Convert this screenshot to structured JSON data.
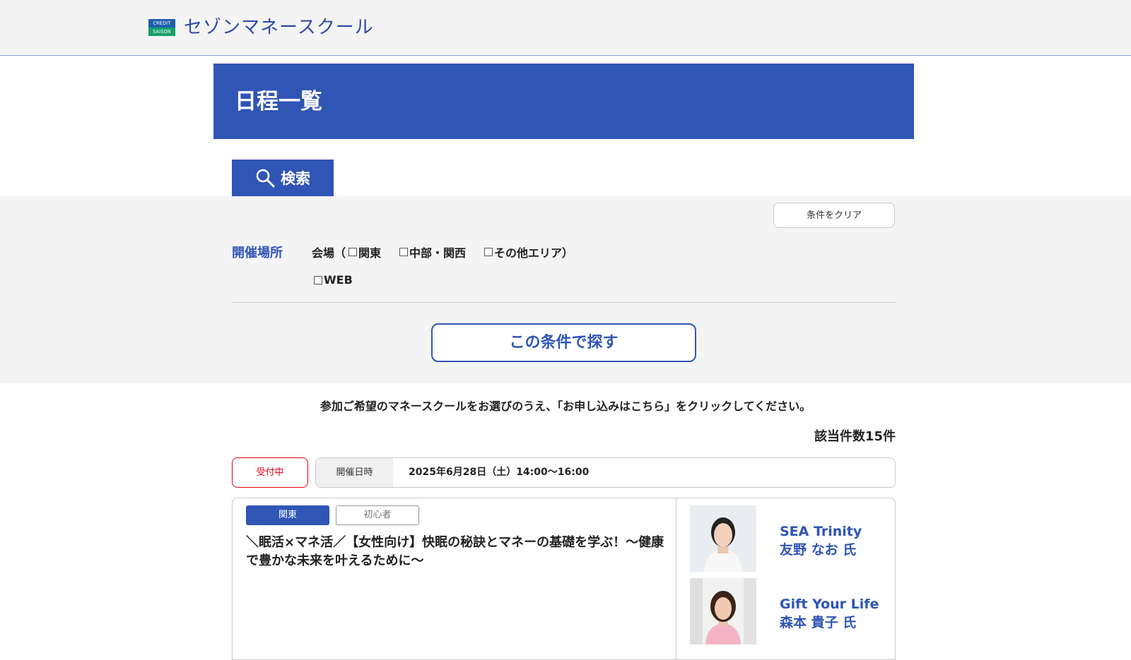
{
  "header": {
    "logo_mark_top": "CREDIT",
    "logo_mark_bottom": "SAISON",
    "logo_text": "セゾンマネースクール"
  },
  "page": {
    "title": "日程一覧"
  },
  "search": {
    "tab_label": "検索",
    "clear_label": "条件をクリア",
    "venue_label": "開催場所",
    "venue_prefix": "会場（",
    "options": [
      "関東",
      "中部・関西",
      "その他エリア）",
      "WEB"
    ],
    "submit_label": "この条件で探す"
  },
  "results": {
    "instruction": "参加ご希望のマネースクールをお選びのうえ、「お申し込みはこちら」をクリックしてください。",
    "count": "該当件数15件"
  },
  "event": {
    "status": "受付中",
    "date_label": "開催日時",
    "date_value": "2025年6月28日（土）14:00〜16:00",
    "tags": [
      "関東",
      "初心者"
    ],
    "title": "＼眠活×マネ活／【女性向け】快眠の秘訣とマネーの基礎を学ぶ！〜健康で豊かな未来を叶えるために〜",
    "speakers": [
      {
        "org": "SEA Trinity",
        "name": "友野 なお 氏"
      },
      {
        "org": "Gift Your Life",
        "name": "森本 貴子 氏"
      }
    ]
  },
  "colors": {
    "brand_blue": "#2f55b5",
    "status_red": "#e60012",
    "panel_bg": "#f4f4f4"
  }
}
